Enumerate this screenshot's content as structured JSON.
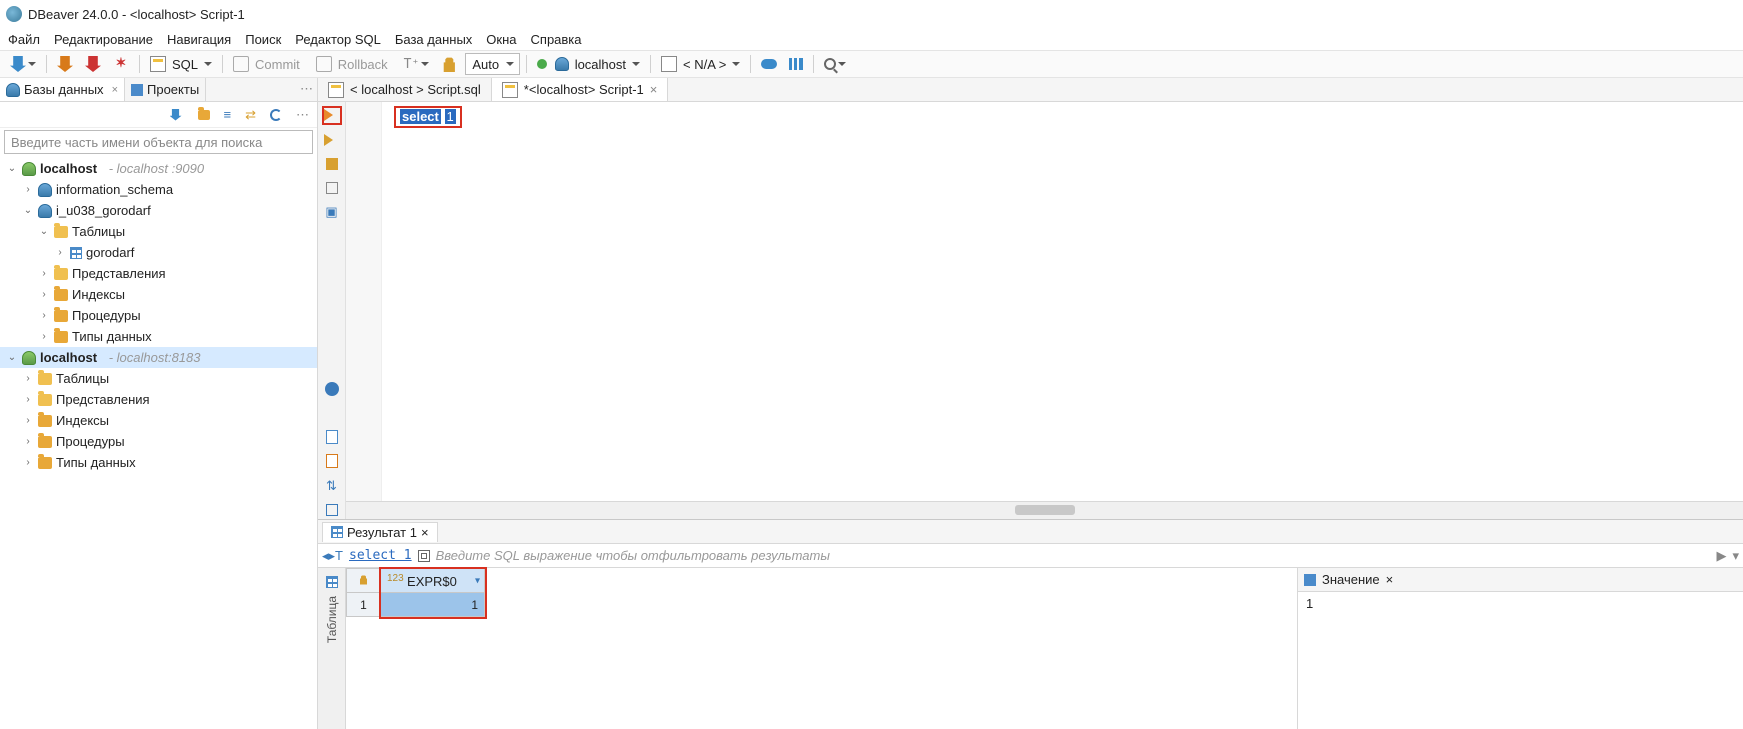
{
  "title": "DBeaver 24.0.0 - <localhost> Script-1",
  "menu": {
    "file": "Файл",
    "edit": "Редактирование",
    "nav": "Навигация",
    "search": "Поиск",
    "sql_editor": "Редактор SQL",
    "database": "База данных",
    "windows": "Окна",
    "help": "Справка"
  },
  "toolbar": {
    "sql": "SQL",
    "commit": "Commit",
    "rollback": "Rollback",
    "auto": "Auto",
    "conn": "localhost",
    "schema": "< N/A >"
  },
  "left": {
    "tab_databases": "Базы данных",
    "tab_projects": "Проекты",
    "search_placeholder": "Введите часть имени объекта для поиска",
    "tree": {
      "c1": {
        "name": "localhost",
        "detail": "- localhost :9090"
      },
      "c1_db1": "information_schema",
      "c1_db2": "i_u038_gorodarf",
      "c1_db2_tables": "Таблицы",
      "c1_db2_table1": "gorodarf",
      "c1_db2_views": "Представления",
      "c1_db2_indexes": "Индексы",
      "c1_db2_procs": "Процедуры",
      "c1_db2_types": "Типы данных",
      "c2": {
        "name": "localhost",
        "detail": "- localhost:8183"
      },
      "c2_tables": "Таблицы",
      "c2_views": "Представления",
      "c2_indexes": "Индексы",
      "c2_procs": "Процедуры",
      "c2_types": "Типы данных"
    }
  },
  "editor": {
    "tab1": "< localhost > Script.sql",
    "tab2": "*<localhost> Script-1",
    "code_keyword": "select",
    "code_arg": "1"
  },
  "results": {
    "tab": "Результат 1",
    "filter_sql": "select 1",
    "filter_hint": "Введите SQL выражение чтобы отфильтровать результаты",
    "side_tab": "Таблица",
    "col_header": "EXPR$0",
    "col_prefix": "123",
    "row_num": "1",
    "cell_value": "1",
    "value_panel_title": "Значение",
    "value_panel_value": "1"
  }
}
